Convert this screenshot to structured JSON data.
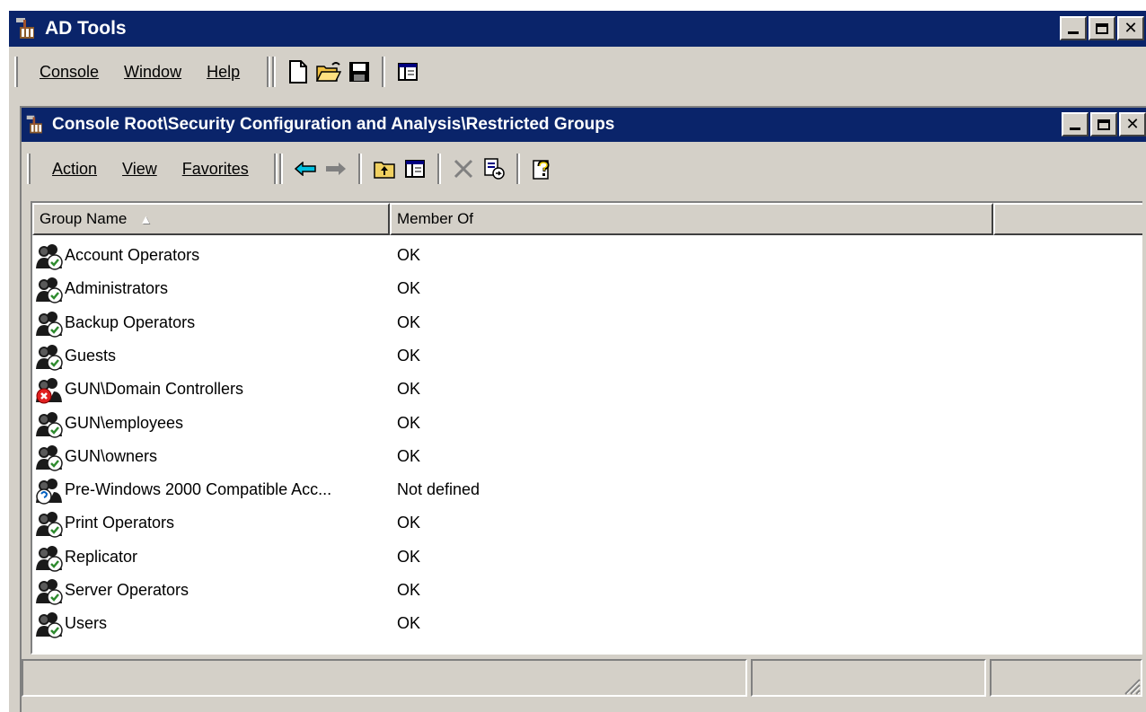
{
  "main_window": {
    "title": "AD Tools"
  },
  "main_menu": {
    "console": "Console",
    "window": "Window",
    "help": "Help"
  },
  "toolbar_icons": [
    "new-icon",
    "open-folder-icon",
    "save-icon",
    "show-hide-tree-icon"
  ],
  "child_window": {
    "title": "Console Root\\Security Configuration and Analysis\\Restricted Groups"
  },
  "child_menu": {
    "action": "Action",
    "view": "View",
    "favorites": "Favorites"
  },
  "child_toolbar_icons": [
    "back-arrow-icon",
    "forward-arrow-icon",
    "up-folder-icon",
    "show-hide-tree-icon",
    "delete-icon",
    "export-list-icon",
    "help-icon"
  ],
  "columns": {
    "group_name": "Group Name",
    "member_of": "Member Of"
  },
  "sort_indicator": "▲",
  "rows": [
    {
      "name": "Account Operators",
      "member_of": "OK",
      "status": "ok"
    },
    {
      "name": "Administrators",
      "member_of": "OK",
      "status": "ok"
    },
    {
      "name": "Backup Operators",
      "member_of": "OK",
      "status": "ok"
    },
    {
      "name": "Guests",
      "member_of": "OK",
      "status": "ok"
    },
    {
      "name": "GUN\\Domain Controllers",
      "member_of": "OK",
      "status": "error"
    },
    {
      "name": "GUN\\employees",
      "member_of": "OK",
      "status": "ok"
    },
    {
      "name": "GUN\\owners",
      "member_of": "OK",
      "status": "ok"
    },
    {
      "name": "Pre-Windows 2000 Compatible Acc...",
      "member_of": "Not defined",
      "status": "undefined"
    },
    {
      "name": "Print Operators",
      "member_of": "OK",
      "status": "ok"
    },
    {
      "name": "Replicator",
      "member_of": "OK",
      "status": "ok"
    },
    {
      "name": "Server Operators",
      "member_of": "OK",
      "status": "ok"
    },
    {
      "name": "Users",
      "member_of": "OK",
      "status": "ok"
    }
  ],
  "colors": {
    "title_bar": "#0a246a",
    "chrome": "#d4d0c8",
    "ok_badge": "#2e8b2e",
    "error_badge": "#e02020"
  }
}
